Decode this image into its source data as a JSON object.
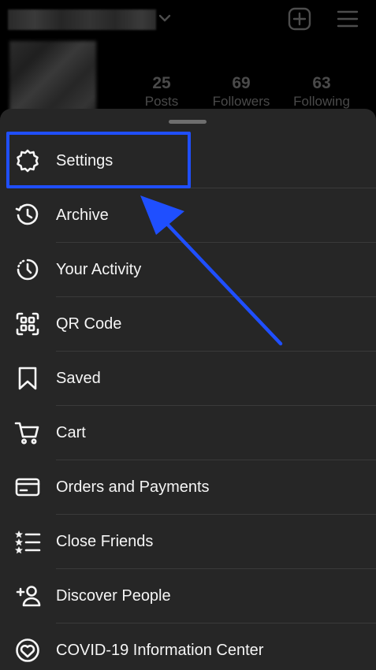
{
  "profile": {
    "stats": [
      {
        "value": "25",
        "label": "Posts"
      },
      {
        "value": "69",
        "label": "Followers"
      },
      {
        "value": "63",
        "label": "Following"
      }
    ]
  },
  "menu": {
    "items": [
      {
        "label": "Settings",
        "icon": "gear-icon"
      },
      {
        "label": "Archive",
        "icon": "archive-icon"
      },
      {
        "label": "Your Activity",
        "icon": "activity-icon"
      },
      {
        "label": "QR Code",
        "icon": "qr-code-icon"
      },
      {
        "label": "Saved",
        "icon": "bookmark-icon"
      },
      {
        "label": "Cart",
        "icon": "cart-icon"
      },
      {
        "label": "Orders and Payments",
        "icon": "card-icon"
      },
      {
        "label": "Close Friends",
        "icon": "close-friends-icon"
      },
      {
        "label": "Discover People",
        "icon": "add-person-icon"
      },
      {
        "label": "COVID-19 Information Center",
        "icon": "covid-info-icon"
      }
    ]
  },
  "annotation": {
    "color": "#1f4fff"
  }
}
